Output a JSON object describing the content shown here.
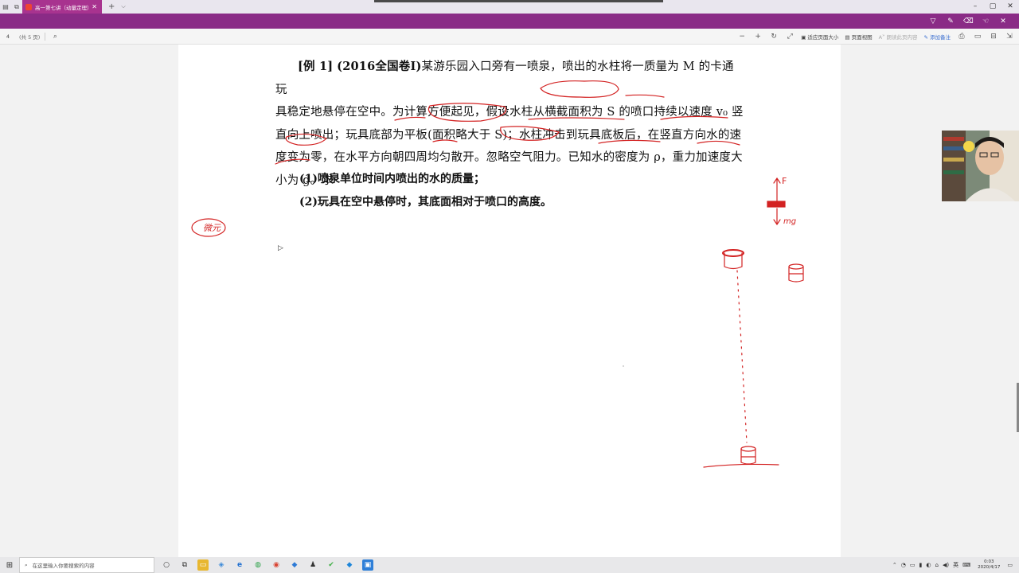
{
  "tabbar": {
    "tab_title": "高一第七讲（动量定理）",
    "close": "✕",
    "new_tab": "+",
    "dropdown": "⌵",
    "win_min": "–",
    "win_max": "▢",
    "win_close": "✕"
  },
  "toolbar": {
    "page_number": "4",
    "page_total": "(共 5 页)",
    "zoom_out": "−",
    "zoom_in": "+",
    "rotate": "↻",
    "fullscreen": "⤢",
    "fit_page": "适应页面大小",
    "page_view": "页面视图",
    "read_aloud": "朗读此页内容",
    "add_note": "添加备注"
  },
  "problem": {
    "label": "[例 1]",
    "source": "(2016全国卷Ⅰ)",
    "lines": [
      "某游乐园入口旁有一喷泉，喷出的水柱将一质量为 M 的卡通玩",
      "具稳定地悬停在空中。为计算方便起见，假设水柱从横截面积为 S 的喷口持续以速度 v₀ 竖",
      "直向上喷出；玩具底部为平板(面积略大于 S)；水柱冲击到玩具底板后，在竖直方向水的速",
      "度变为零，在水平方向朝四周均匀散开。忽略空气阻力。已知水的密度为 ρ，重力加速度大",
      "小为 g。求"
    ],
    "q1": "(1)喷泉单位时间内喷出的水的质量；",
    "q2": "(2)玩具在空中悬停时，其底面相对于喷口的高度。"
  },
  "annotations": {
    "circled_note": "微元",
    "force_up": "F",
    "force_down": "mg"
  },
  "taskbar": {
    "search_placeholder": "在这里输入你要搜索的内容",
    "lang": "英",
    "time": "0:03",
    "date": "2020/4/17"
  },
  "colors": {
    "accent_purple": "#8a2b86",
    "tab_magenta": "#a8338f",
    "ink_red": "#d32222"
  }
}
